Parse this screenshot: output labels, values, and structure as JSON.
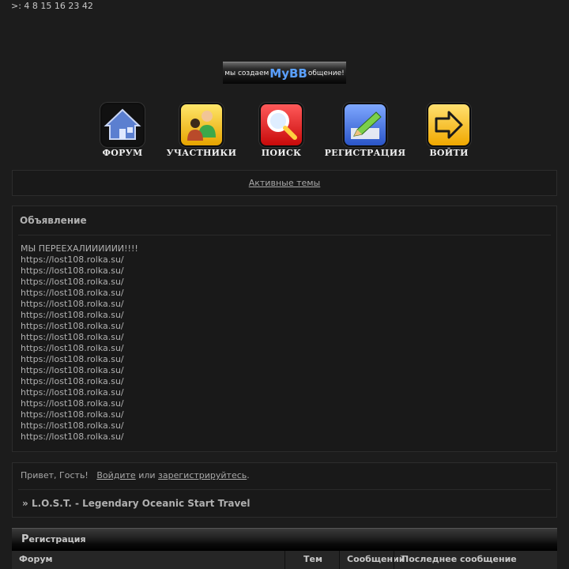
{
  "top_text": ">: 4 8 15 16 23 42",
  "banner": {
    "left": "мы создаем",
    "brand": "MyBB",
    "right": "общение!"
  },
  "nav": [
    {
      "label": "ФОРУМ",
      "icon": "home-icon"
    },
    {
      "label": "УЧАСТНИКИ",
      "icon": "users-icon"
    },
    {
      "label": "ПОИСК",
      "icon": "search-icon"
    },
    {
      "label": "РЕГИСТРАЦИЯ",
      "icon": "pencil-icon"
    },
    {
      "label": "ВОЙТИ",
      "icon": "login-arrow-icon"
    }
  ],
  "active_topics": "Активные темы",
  "announcement": {
    "title": "Объявление",
    "headline": "МЫ ПЕРЕЕХАЛИИИИИИ!!!!",
    "links": [
      "https://lost108.rolka.su/",
      "https://lost108.rolka.su/",
      "https://lost108.rolka.su/",
      "https://lost108.rolka.su/",
      "https://lost108.rolka.su/",
      "https://lost108.rolka.su/",
      "https://lost108.rolka.su/",
      "https://lost108.rolka.su/",
      "https://lost108.rolka.su/",
      "https://lost108.rolka.su/",
      "https://lost108.rolka.su/",
      "https://lost108.rolka.su/",
      "https://lost108.rolka.su/",
      "https://lost108.rolka.su/",
      "https://lost108.rolka.su/",
      "https://lost108.rolka.su/",
      "https://lost108.rolka.su/"
    ]
  },
  "welcome": {
    "greeting": "Привет, Гость!",
    "login_link": "Войдите",
    "or": "или",
    "register_link": "зарегистрируйтесь",
    "period": ".",
    "crumb_prefix": "»",
    "forum_title": "L.O.S.T. - Legendary Oceanic Start Travel"
  },
  "category": {
    "first_letter": "Р",
    "rest": "егистрация"
  },
  "table_headers": {
    "forum": "Форум",
    "topics": "Тем",
    "posts": "Сообщений",
    "last_post": "Последнее сообщение"
  }
}
